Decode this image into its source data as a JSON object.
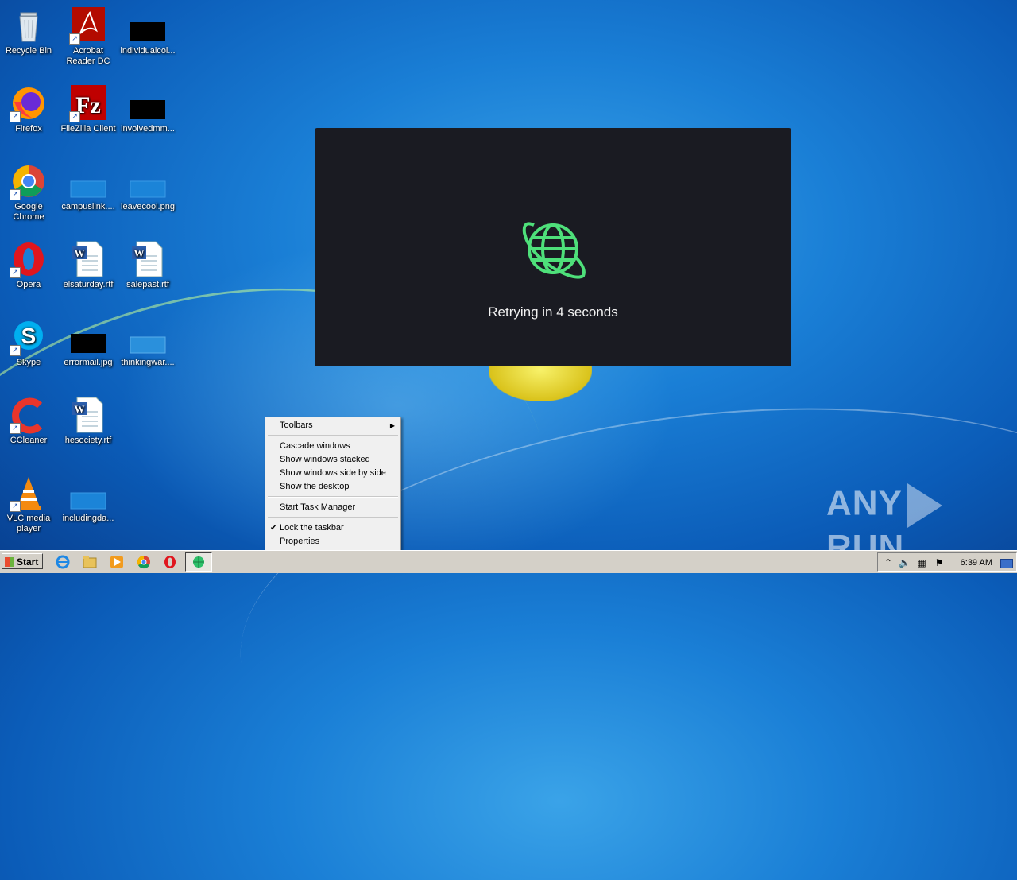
{
  "desktop": {
    "icons": [
      {
        "label": "Recycle Bin"
      },
      {
        "label": "Acrobat Reader DC"
      },
      {
        "label": "individualcol..."
      },
      {
        "label": "Firefox"
      },
      {
        "label": "FileZilla Client"
      },
      {
        "label": "involvedmm..."
      },
      {
        "label": "Google Chrome"
      },
      {
        "label": "campuslink...."
      },
      {
        "label": "leavecool.png"
      },
      {
        "label": "Opera"
      },
      {
        "label": "elsaturday.rtf"
      },
      {
        "label": "salepast.rtf"
      },
      {
        "label": "Skype"
      },
      {
        "label": "errormail.jpg"
      },
      {
        "label": "thinkingwar...."
      },
      {
        "label": "CCleaner"
      },
      {
        "label": "hesociety.rtf"
      },
      {
        "label": "VLC media player"
      },
      {
        "label": "includingda..."
      }
    ]
  },
  "dialog": {
    "message": "Retrying in 4 seconds",
    "icon": "globe-icon",
    "accent": "#4ee07a"
  },
  "context_menu": {
    "items": [
      {
        "label": "Toolbars"
      },
      {
        "label": "Cascade windows"
      },
      {
        "label": "Show windows stacked"
      },
      {
        "label": "Show windows side by side"
      },
      {
        "label": "Show the desktop"
      },
      {
        "label": "Start Task Manager"
      },
      {
        "label": "Lock the taskbar"
      },
      {
        "label": "Properties"
      }
    ]
  },
  "watermark": {
    "left": "ANY",
    "right": "RUN"
  },
  "taskbar": {
    "start_label": "Start",
    "clock": "6:39 AM"
  }
}
